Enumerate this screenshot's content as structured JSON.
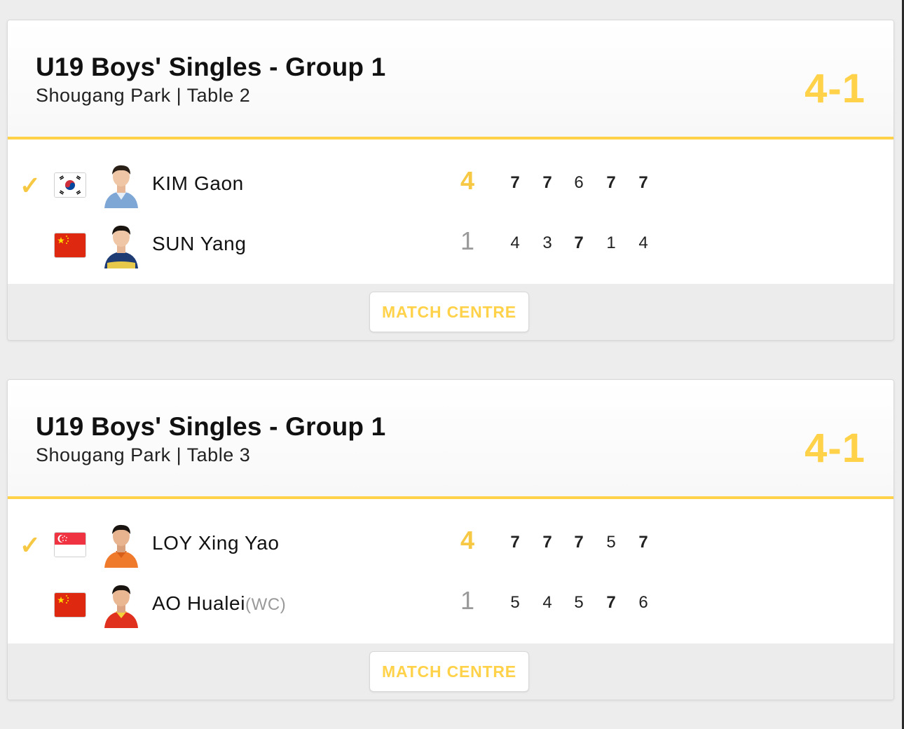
{
  "matches": [
    {
      "title": "U19 Boys' Singles - Group 1",
      "venue": "Shougang Park | Table 2",
      "score": "4-1",
      "button": "MATCH CENTRE",
      "players": [
        {
          "name": "KIM Gaon",
          "wc": "",
          "country": "KOR",
          "flag_icon": "korea-flag-icon",
          "winner": true,
          "games": "4",
          "sets": [
            "7",
            "7",
            "6",
            "7",
            "7"
          ],
          "bold": [
            true,
            true,
            false,
            true,
            true
          ]
        },
        {
          "name": "SUN Yang",
          "wc": "",
          "country": "CHN",
          "flag_icon": "china-flag-icon",
          "winner": false,
          "games": "1",
          "sets": [
            "4",
            "3",
            "7",
            "1",
            "4"
          ],
          "bold": [
            false,
            false,
            true,
            false,
            false
          ]
        }
      ]
    },
    {
      "title": "U19 Boys' Singles - Group 1",
      "venue": "Shougang Park | Table 3",
      "score": "4-1",
      "button": "MATCH CENTRE",
      "players": [
        {
          "name": "LOY Xing Yao",
          "wc": "",
          "country": "SGP",
          "flag_icon": "singapore-flag-icon",
          "winner": true,
          "games": "4",
          "sets": [
            "7",
            "7",
            "7",
            "5",
            "7"
          ],
          "bold": [
            true,
            true,
            true,
            false,
            true
          ]
        },
        {
          "name": "AO Hualei",
          "wc": "(WC)",
          "country": "CHN",
          "flag_icon": "china-flag-icon",
          "winner": false,
          "games": "1",
          "sets": [
            "5",
            "4",
            "5",
            "7",
            "6"
          ],
          "bold": [
            false,
            false,
            false,
            true,
            false
          ]
        }
      ]
    }
  ],
  "colors": {
    "accent": "#ffd24a",
    "check": "#f7c843"
  }
}
